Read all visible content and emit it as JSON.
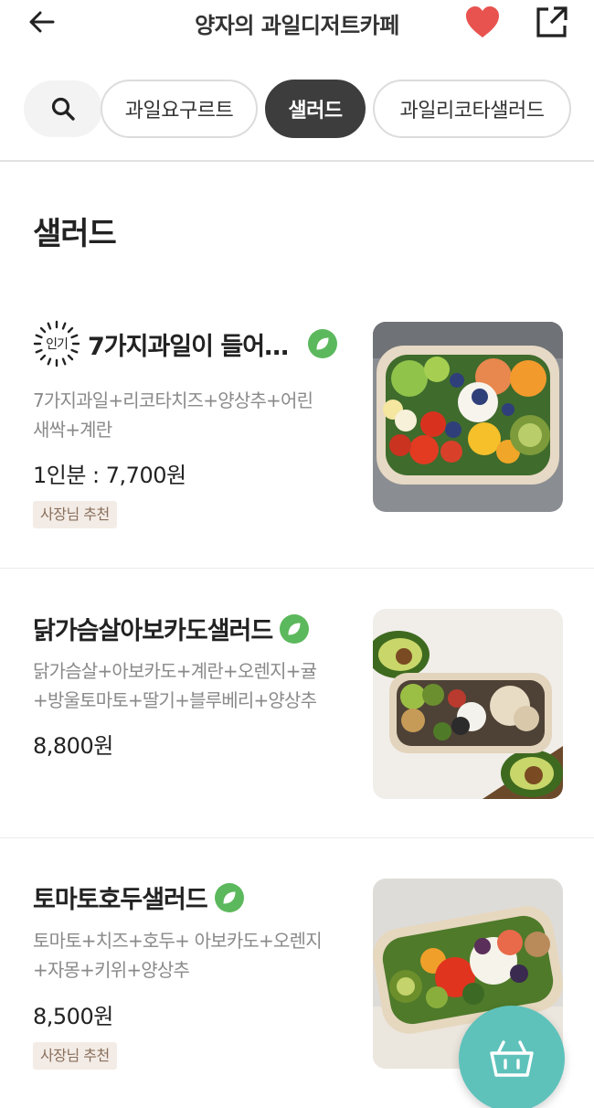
{
  "header": {
    "title": "양자의 과일디저트카페",
    "heart_color": "#e8534f"
  },
  "categories": [
    {
      "label": "과일요구르트",
      "active": false
    },
    {
      "label": "샐러드",
      "active": true
    },
    {
      "label": "과일리코타샐러드",
      "active": false
    }
  ],
  "section": {
    "title": "샐러드"
  },
  "items": [
    {
      "popular_label": "인기",
      "name": "7가지과일이 들어…",
      "desc_line1": "7가지과일+리코타치즈+양상추+어린",
      "desc_line2": "새싹+계란",
      "price": "1인분 : 7,700원",
      "badge": "사장님 추천",
      "leaf_icon": "leaf-icon"
    },
    {
      "name": "닭가슴살아보카도샐러드",
      "desc_line1": "닭가슴살+아보카도+계란+오렌지+귤",
      "desc_line2": "+방울토마토+딸기+블루베리+양상추",
      "price": "8,800원",
      "leaf_icon": "leaf-icon"
    },
    {
      "name": "토마토호두샐러드",
      "desc_line1": "토마토+치즈+호두+ 아보카도+오렌지",
      "desc_line2": "+자몽+키위+양상추",
      "price": "8,500원",
      "badge": "사장님 추천",
      "leaf_icon": "leaf-icon"
    }
  ],
  "colors": {
    "accent_teal": "#5ec2bb",
    "leaf_green": "#5cb85c",
    "active_chip": "#3d3d3d"
  }
}
